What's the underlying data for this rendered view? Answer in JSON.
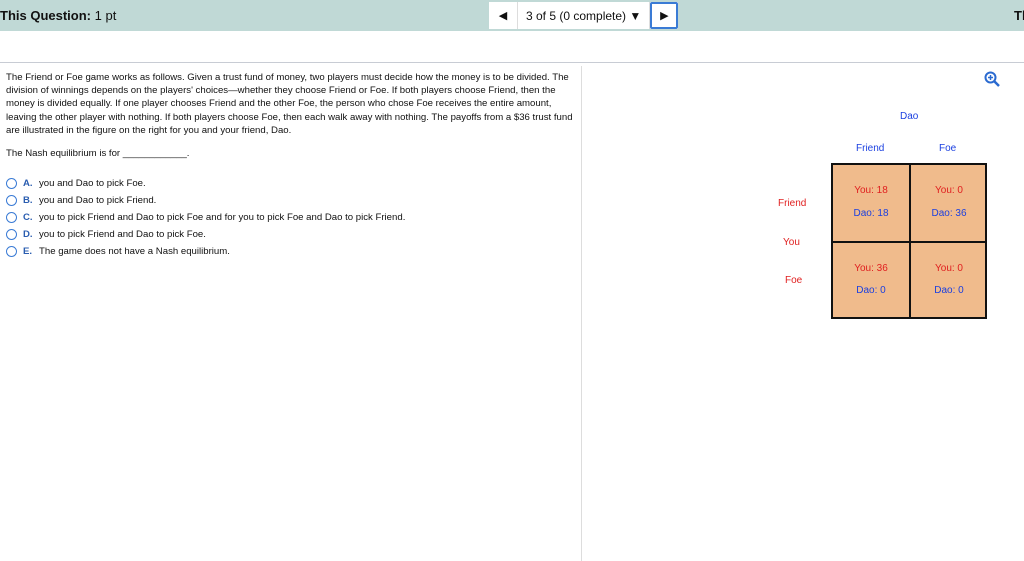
{
  "header": {
    "question_label": "This Question:",
    "points": "1 pt",
    "progress": "3 of 5 (0 complete)",
    "right_cut": "Th"
  },
  "question": {
    "text": "The Friend or Foe game works as follows. Given a trust fund of money, two players must decide how the money is to be divided. The division of winnings depends on the players' choices—whether they choose Friend or Foe. If both players choose Friend, then the money is divided equally. If one player chooses Friend and the other Foe, the person who chose Foe receives the entire amount, leaving the other player with nothing. If both players choose Foe, then each walk away with nothing. The payoffs from a $36 trust fund are illustrated in the figure  on the right for you and your friend, Dao.",
    "prompt": "The Nash equilibrium is for ____________."
  },
  "options": [
    {
      "letter": "A.",
      "text": "you and Dao to pick Foe."
    },
    {
      "letter": "B.",
      "text": "you and Dao to pick Friend."
    },
    {
      "letter": "C.",
      "text": "you to pick Friend and Dao to pick Foe and for you to pick Foe and Dao to pick Friend."
    },
    {
      "letter": "D.",
      "text": "you to pick Friend and Dao to pick Foe."
    },
    {
      "letter": "E.",
      "text": "The game does not have a Nash equilibrium."
    }
  ],
  "matrix": {
    "col_player": "Dao",
    "row_player": "You",
    "col_labels": [
      "Friend",
      "Foe"
    ],
    "row_labels": [
      "Friend",
      "Foe"
    ],
    "cells": [
      [
        {
          "you": "You: 18",
          "dao": "Dao: 18"
        },
        {
          "you": "You: 0",
          "dao": "Dao: 36"
        }
      ],
      [
        {
          "you": "You: 36",
          "dao": "Dao: 0"
        },
        {
          "you": "You: 0",
          "dao": "Dao: 0"
        }
      ]
    ]
  }
}
